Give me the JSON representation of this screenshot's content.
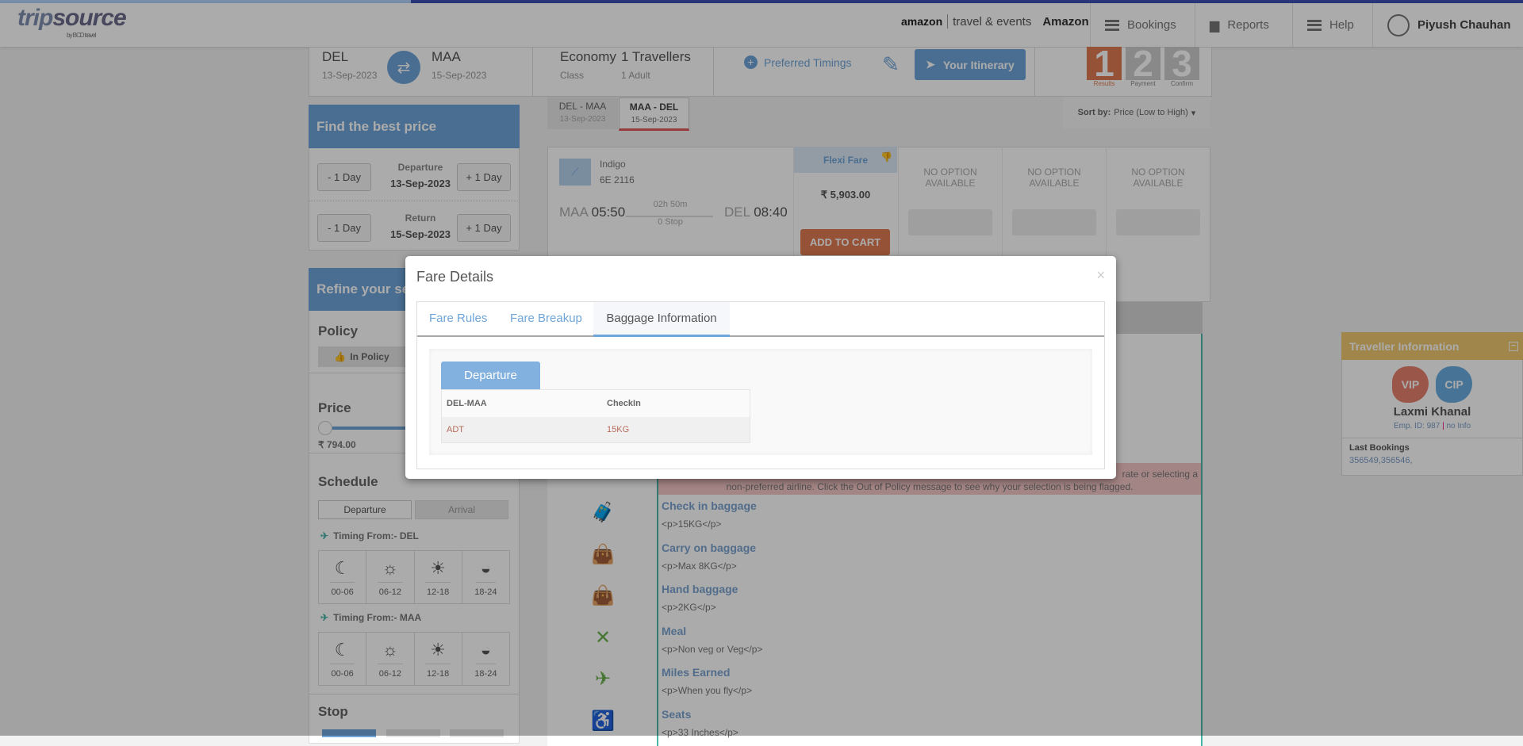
{
  "header": {
    "logo": "tripsource",
    "logo_sub": "by BCD travel",
    "brand": "amazon",
    "brand_sub": "travel & events",
    "company": "Amazon",
    "nav": [
      {
        "label": "Bookings",
        "icon": "list-icon"
      },
      {
        "label": "Reports",
        "icon": "bar-chart-icon"
      },
      {
        "label": "Help",
        "icon": "list-icon"
      }
    ],
    "user": "Piyush Chauhan"
  },
  "progress": {
    "fraction": 0.27
  },
  "search": {
    "from": "DEL",
    "from_date": "13-Sep-2023",
    "to": "MAA",
    "to_date": "15-Sep-2023",
    "class": "Economy",
    "class_label": "Class",
    "travellers": "1 Travellers",
    "travellers_sub": "1 Adult",
    "preferred_timings": "Preferred Timings",
    "itinerary": "Your Itinerary",
    "steps": [
      {
        "n": "1",
        "label": "Results"
      },
      {
        "n": "2",
        "label": "Payment"
      },
      {
        "n": "3",
        "label": "Confirm"
      }
    ]
  },
  "best_price": {
    "title": "Find the best price",
    "minus": "- 1 Day",
    "plus": "+ 1 Day",
    "departure_label": "Departure",
    "departure_date": "13-Sep-2023",
    "return_label": "Return",
    "return_date": "15-Sep-2023"
  },
  "refine": {
    "title": "Refine your search",
    "policy": "Policy",
    "in_policy": "In Policy",
    "price": "Price",
    "price_min": "₹ 794.00",
    "schedule": "Schedule",
    "tab_departure": "Departure",
    "tab_arrival": "Arrival",
    "timing_del": "Timing From:- DEL",
    "timing_maa": "Timing From:- MAA",
    "slots": [
      "00-06",
      "06-12",
      "12-18",
      "18-24"
    ],
    "stop": "Stop"
  },
  "route_tabs": [
    {
      "route": "DEL  -  MAA",
      "date": "13-Sep-2023"
    },
    {
      "route": "MAA  -  DEL",
      "date": "15-Sep-2023"
    }
  ],
  "sort": {
    "label": "Sort by:",
    "value": "Price (Low to High)"
  },
  "flight": {
    "airline": "Indigo",
    "number": "6E  2116",
    "dep_code": "MAA",
    "dep_time": "05:50",
    "duration": "02h 50m",
    "stops": "0 Stop",
    "arr_code": "DEL",
    "arr_time": "08:40",
    "fare_name": "Flexi Fare",
    "price": "₹ 5,903.00",
    "add_to_cart": "ADD TO CART",
    "no_option": "NO OPTION AVAILABLE"
  },
  "policy_msg": {
    "line1": "rate or selecting a",
    "line2": "non-preferred airline. Click the Out of Policy message to see why your selection is being flagged."
  },
  "details": [
    {
      "title": "Check in baggage",
      "text": "<p>15KG</p>",
      "icon": "luggage-icon"
    },
    {
      "title": "Carry on baggage",
      "text": "<p>Max 8KG</p>",
      "icon": "bag-icon"
    },
    {
      "title": "Hand baggage",
      "text": "<p>2KG</p>",
      "icon": "bag-icon"
    },
    {
      "title": "Meal",
      "text": "<p>Non veg or Veg</p>",
      "icon": "cutlery-icon"
    },
    {
      "title": "Miles Earned",
      "text": "<p>When you fly</p>",
      "icon": "plane-icon"
    },
    {
      "title": "Seats",
      "text": "<p>33 Inches</p>",
      "icon": "seat-icon"
    }
  ],
  "traveller": {
    "title": "Traveller Information",
    "vip": "VIP",
    "cip": "CIP",
    "name": "Laxmi Khanal",
    "emp": "Emp. ID: 987",
    "sep": "|",
    "info": "no Info",
    "last_bookings_label": "Last Bookings",
    "last_bookings": "356549,356546,"
  },
  "modal": {
    "title": "Fare Details",
    "close": "×",
    "tabs": [
      "Fare Rules",
      "Fare Breakup",
      "Baggage Information"
    ],
    "active_tab": "Baggage Information",
    "sub_tab": "Departure",
    "table": {
      "headers": [
        "DEL-MAA",
        "CheckIn"
      ],
      "rows": [
        [
          "ADT",
          "15KG"
        ]
      ]
    }
  },
  "colors": {
    "accent": "#6fa5d8",
    "cart": "#e07b53",
    "gold": "#d4b26a",
    "green": "#6ab04c",
    "vip": "#e8806f",
    "cip": "#6aaee0"
  }
}
